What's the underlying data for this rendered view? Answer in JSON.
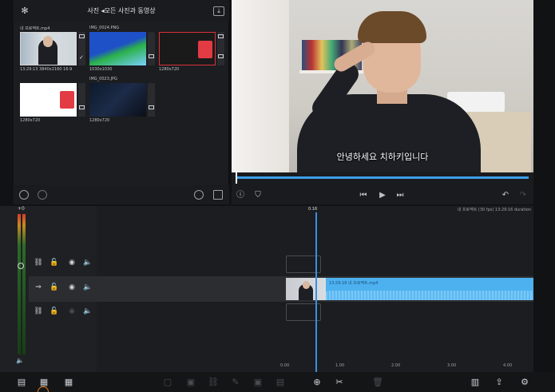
{
  "browser": {
    "title": "사진 ◂모든 사진과 동영상",
    "items": [
      {
        "name": "내 프로젝트.mp4",
        "meta": "13:29:13  3840x2160  16:9"
      },
      {
        "name": "IMG_0024.PNG",
        "meta": "1030x1030"
      },
      {
        "name": "",
        "meta": "1280x720"
      },
      {
        "name": "",
        "meta": "1280x720"
      },
      {
        "name": "IMG_0023.JPG",
        "meta": "1280x720"
      }
    ]
  },
  "preview": {
    "subtitle": "안녕하세요 치하키입니다"
  },
  "timeline": {
    "level_label": "+0",
    "playhead_time": "0.16",
    "info": "내 프로젝트 (30 fps) 13:29:16 duration",
    "clip_label": "13:29:16  내 프로젝트.mp4",
    "ruler": [
      "0.00",
      "1.00",
      "2.00",
      "3.00",
      "4.00"
    ]
  },
  "colors": {
    "accent": "#3aa0e8",
    "clip": "#4db1f0",
    "record": "#e07a1a"
  }
}
